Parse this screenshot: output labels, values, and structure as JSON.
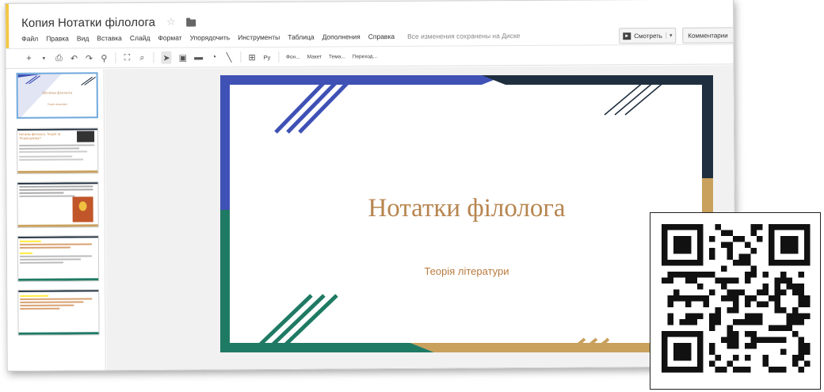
{
  "window": {
    "doc_title": "Копия Нотатки філолога",
    "accent": "#f2c744"
  },
  "menu": {
    "items": [
      "Файл",
      "Правка",
      "Вид",
      "Вставка",
      "Слайд",
      "Формат",
      "Упорядочить",
      "Инструменты",
      "Таблица",
      "Дополнения",
      "Справка"
    ],
    "save_status": "Все изменения сохранены на Диске"
  },
  "actions": {
    "present_label": "Смотреть",
    "present_dropdown": "▾",
    "comments_label": "Комментарии"
  },
  "toolbar": {
    "font_label": "Фон...",
    "layout_label": "Макет",
    "theme_label": "Тема...",
    "transition_label": "Переход...",
    "text_glyph": "Ру"
  },
  "filmstrip": {
    "slides": [
      {
        "title": "Нотатки філолога",
        "subtitle": "Теорія літератури"
      },
      {
        "title": "Нотатки філолога. Теорія та Теорія доказу?"
      },
      {
        "title": ""
      },
      {
        "title": ""
      },
      {
        "title": ""
      }
    ]
  },
  "slide": {
    "title": "Нотатки філолога",
    "subtitle": "Теорія літератури",
    "colors": {
      "blue": "#3f51b5",
      "navy": "#1f2f3f",
      "green": "#1f7a64",
      "gold": "#c9a05c",
      "title_text": "#b7854f"
    }
  }
}
